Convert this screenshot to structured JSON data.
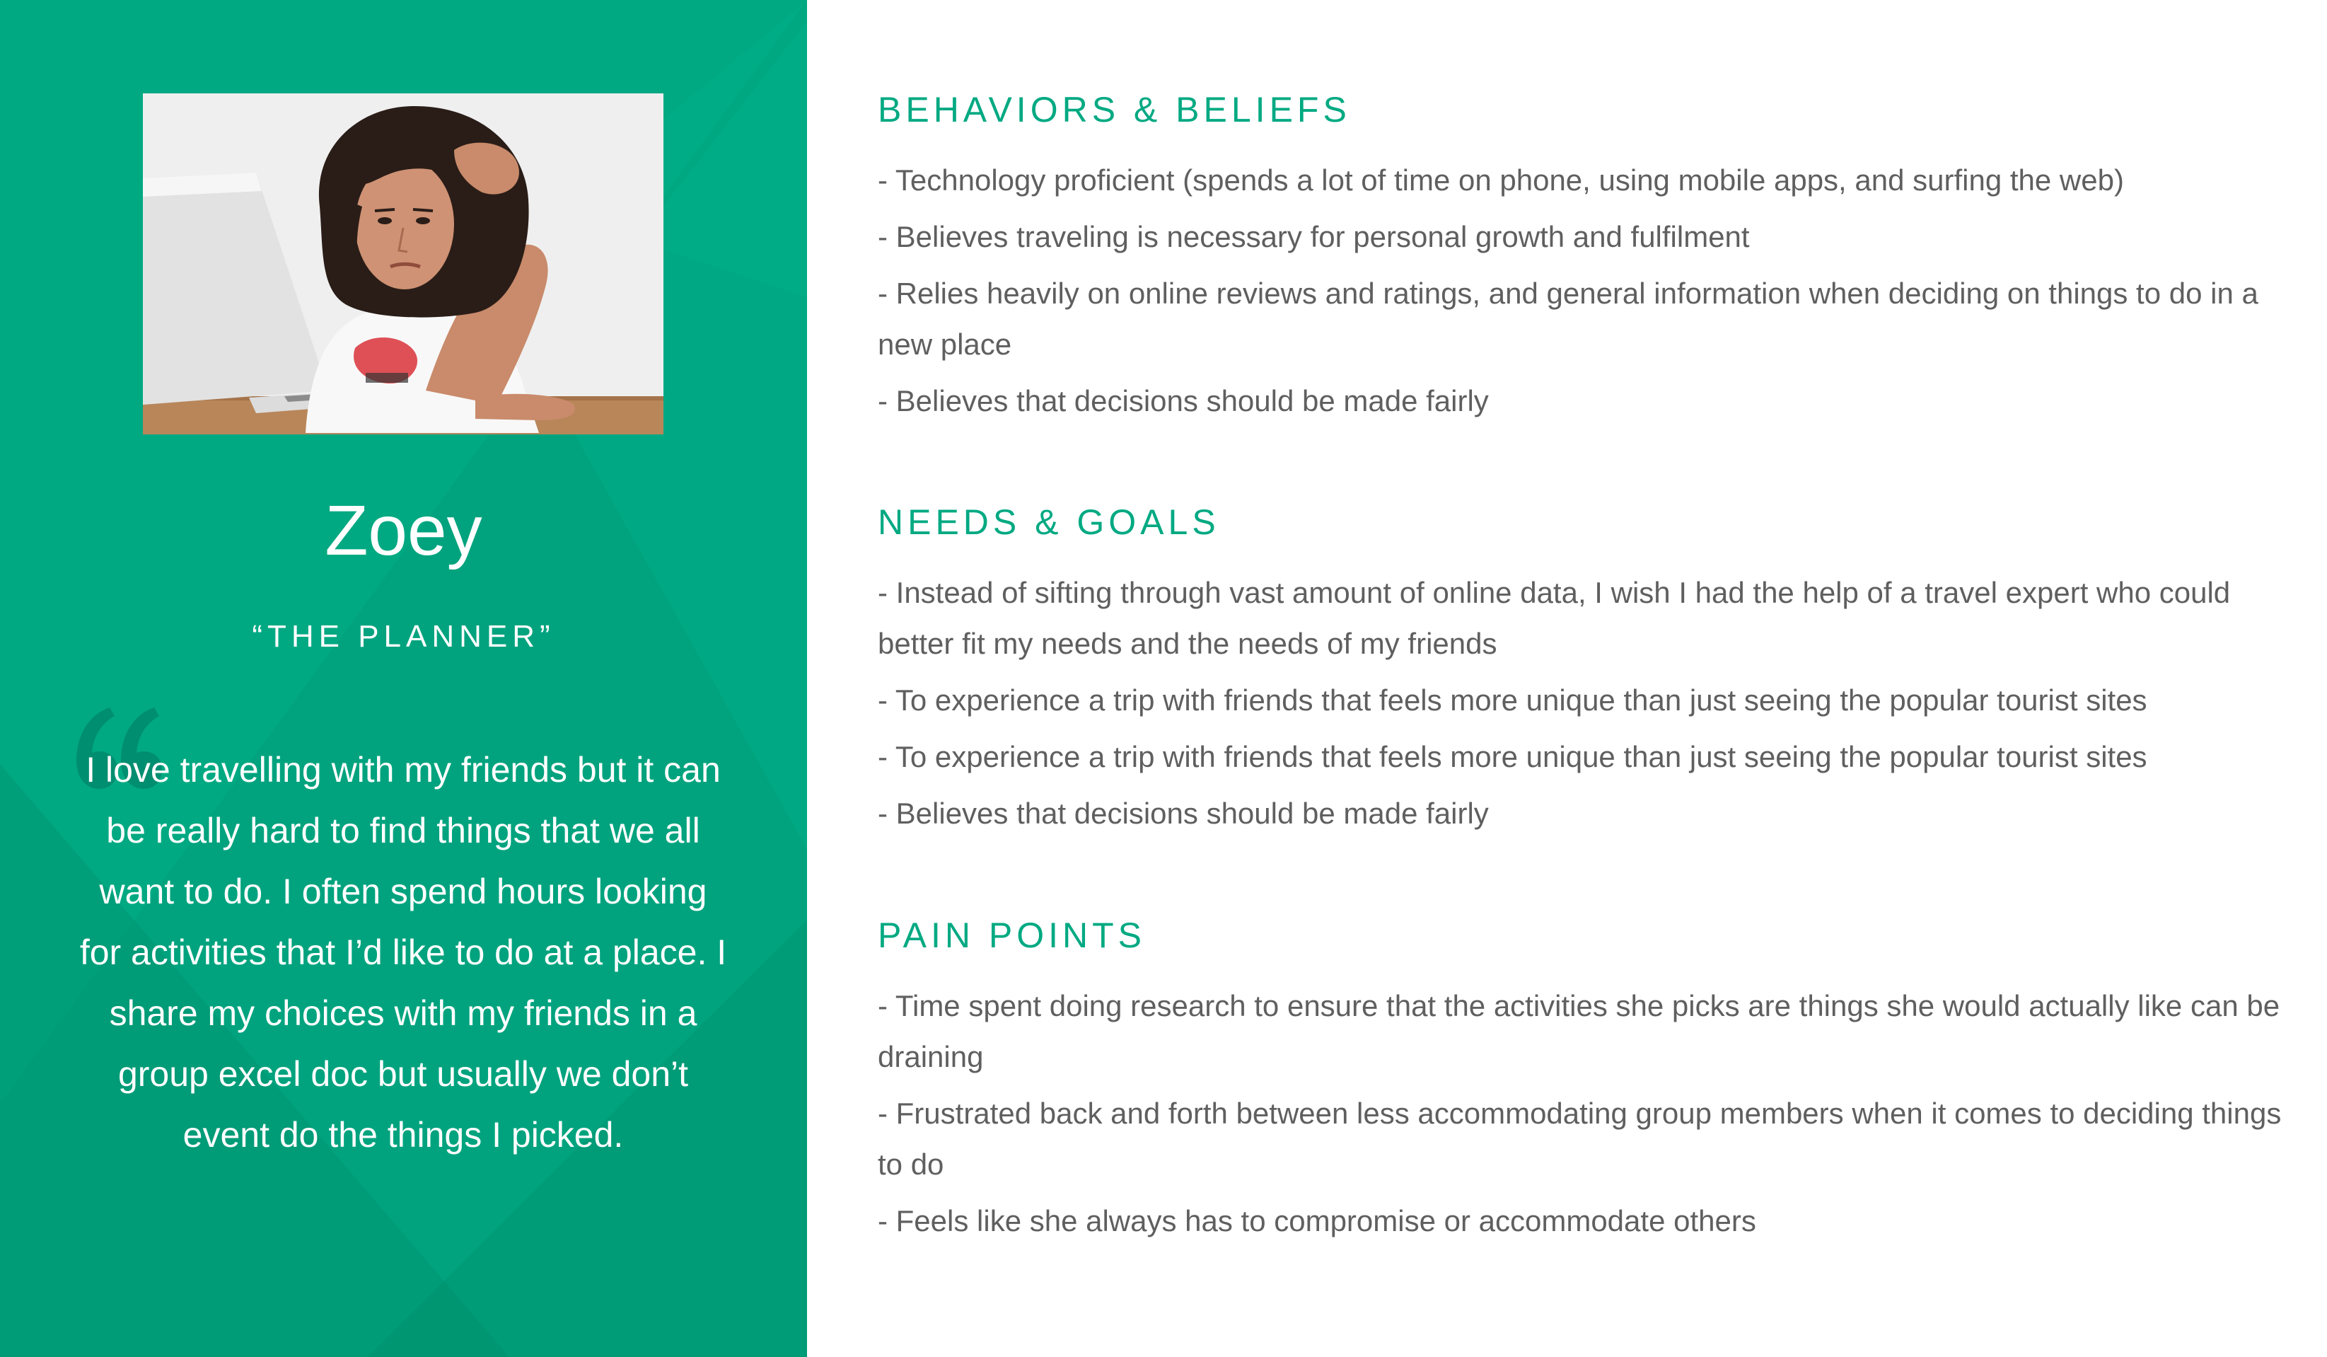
{
  "persona": {
    "name": "Zoey",
    "subtitle": "“THE PLANNER”",
    "photo_icon": "person-at-laptop-photo",
    "quote": "I love travelling with my friends but it can be really hard to find things that we all want to do. I often spend hours looking for activities that I’d like to do at a place. I share my choices with my friends in a group excel doc but usually we don’t event do the things I picked."
  },
  "colors": {
    "accent": "#00a982",
    "accent_dark": "#00906f",
    "body_text": "#5f5f5f",
    "white": "#ffffff"
  },
  "sections": [
    {
      "title": "BEHAVIORS & BELIEFS",
      "items": [
        "- Technology proficient (spends a lot of time on phone, using mobile apps, and surfing the web)",
        "- Believes traveling is necessary for personal growth and fulfilment",
        "- Relies heavily on online reviews and ratings, and general information when deciding on things to do in a new place",
        "- Believes that decisions should be made fairly"
      ]
    },
    {
      "title": "NEEDS & GOALS",
      "items": [
        "- Instead of sifting through vast amount of online data, I wish I had the help of a travel expert who could better fit my needs and the needs of my friends",
        "- To experience a trip with friends that feels more unique than just seeing the popular tourist sites",
        "- To experience a trip with friends that feels more unique than just seeing the popular tourist sites",
        "- Believes that decisions should be made fairly"
      ]
    },
    {
      "title": "PAIN POINTS",
      "items": [
        "- Time spent doing research to ensure that the activities she picks are things she would actually like can be draining",
        "- Frustrated back and forth between less accommodating group members when it comes to deciding things to do",
        "- Feels like she always has to compromise or accommodate others"
      ]
    }
  ]
}
